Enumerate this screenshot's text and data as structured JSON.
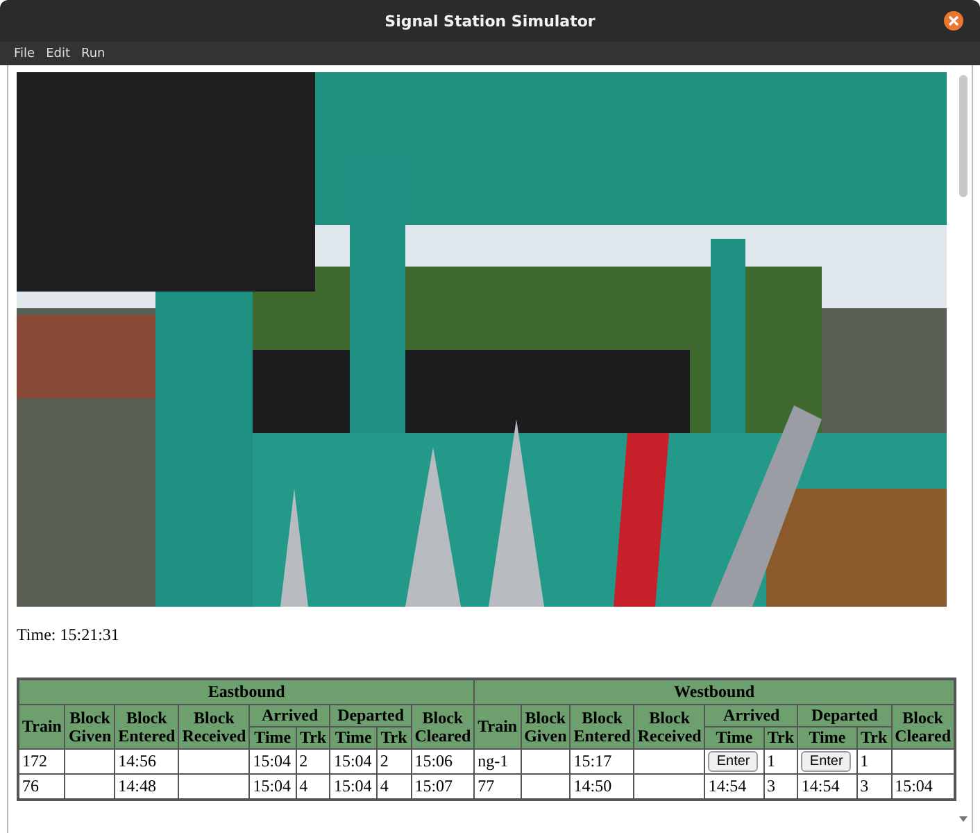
{
  "window": {
    "title": "Signal Station Simulator"
  },
  "menu": [
    {
      "label": "File"
    },
    {
      "label": "Edit"
    },
    {
      "label": "Run"
    }
  ],
  "time": "Time: 15:21:31",
  "table": {
    "groups": [
      {
        "title": "Eastbound",
        "columns": [
          {
            "label": "Train"
          },
          {
            "label": "Block Given"
          },
          {
            "label": "Block Entered"
          },
          {
            "label": "Block Received"
          },
          {
            "label": "Arrived",
            "sub": [
              "Time",
              "Trk"
            ]
          },
          {
            "label": "Departed",
            "sub": [
              "Time",
              "Trk"
            ]
          },
          {
            "label": "Block Cleared"
          }
        ]
      },
      {
        "title": "Westbound",
        "columns": [
          {
            "label": "Train"
          },
          {
            "label": "Block Given"
          },
          {
            "label": "Block Entered"
          },
          {
            "label": "Block Received"
          },
          {
            "label": "Arrived",
            "sub": [
              "Time",
              "Trk"
            ]
          },
          {
            "label": "Departed",
            "sub": [
              "Time",
              "Trk"
            ]
          },
          {
            "label": "Block Cleared"
          }
        ]
      }
    ],
    "rows": [
      {
        "cells": [
          {
            "kind": "text",
            "text": "172"
          },
          {
            "kind": "blank"
          },
          {
            "kind": "text",
            "text": "14:56"
          },
          {
            "kind": "blank"
          },
          {
            "kind": "text",
            "text": "15:04"
          },
          {
            "kind": "text",
            "text": "2"
          },
          {
            "kind": "text",
            "text": "15:04"
          },
          {
            "kind": "text",
            "text": "2"
          },
          {
            "kind": "text",
            "text": "15:06"
          },
          {
            "kind": "text",
            "text": "ng-1"
          },
          {
            "kind": "blank"
          },
          {
            "kind": "text",
            "text": "15:17"
          },
          {
            "kind": "blank"
          },
          {
            "kind": "button",
            "text": "Enter"
          },
          {
            "kind": "text",
            "text": "1"
          },
          {
            "kind": "button",
            "text": "Enter"
          },
          {
            "kind": "text",
            "text": "1"
          },
          {
            "kind": "blank"
          }
        ]
      },
      {
        "cells": [
          {
            "kind": "text",
            "text": "76"
          },
          {
            "kind": "blank"
          },
          {
            "kind": "text",
            "text": "14:48"
          },
          {
            "kind": "blank"
          },
          {
            "kind": "text",
            "text": "15:04"
          },
          {
            "kind": "text",
            "text": "4"
          },
          {
            "kind": "text",
            "text": "15:04"
          },
          {
            "kind": "text",
            "text": "4"
          },
          {
            "kind": "text",
            "text": "15:07"
          },
          {
            "kind": "text",
            "text": "77"
          },
          {
            "kind": "blank"
          },
          {
            "kind": "text",
            "text": "14:50"
          },
          {
            "kind": "blank"
          },
          {
            "kind": "text",
            "text": "14:54"
          },
          {
            "kind": "text",
            "text": "3"
          },
          {
            "kind": "text",
            "text": "14:54"
          },
          {
            "kind": "text",
            "text": "3"
          },
          {
            "kind": "text",
            "text": "15:04"
          }
        ]
      }
    ]
  }
}
